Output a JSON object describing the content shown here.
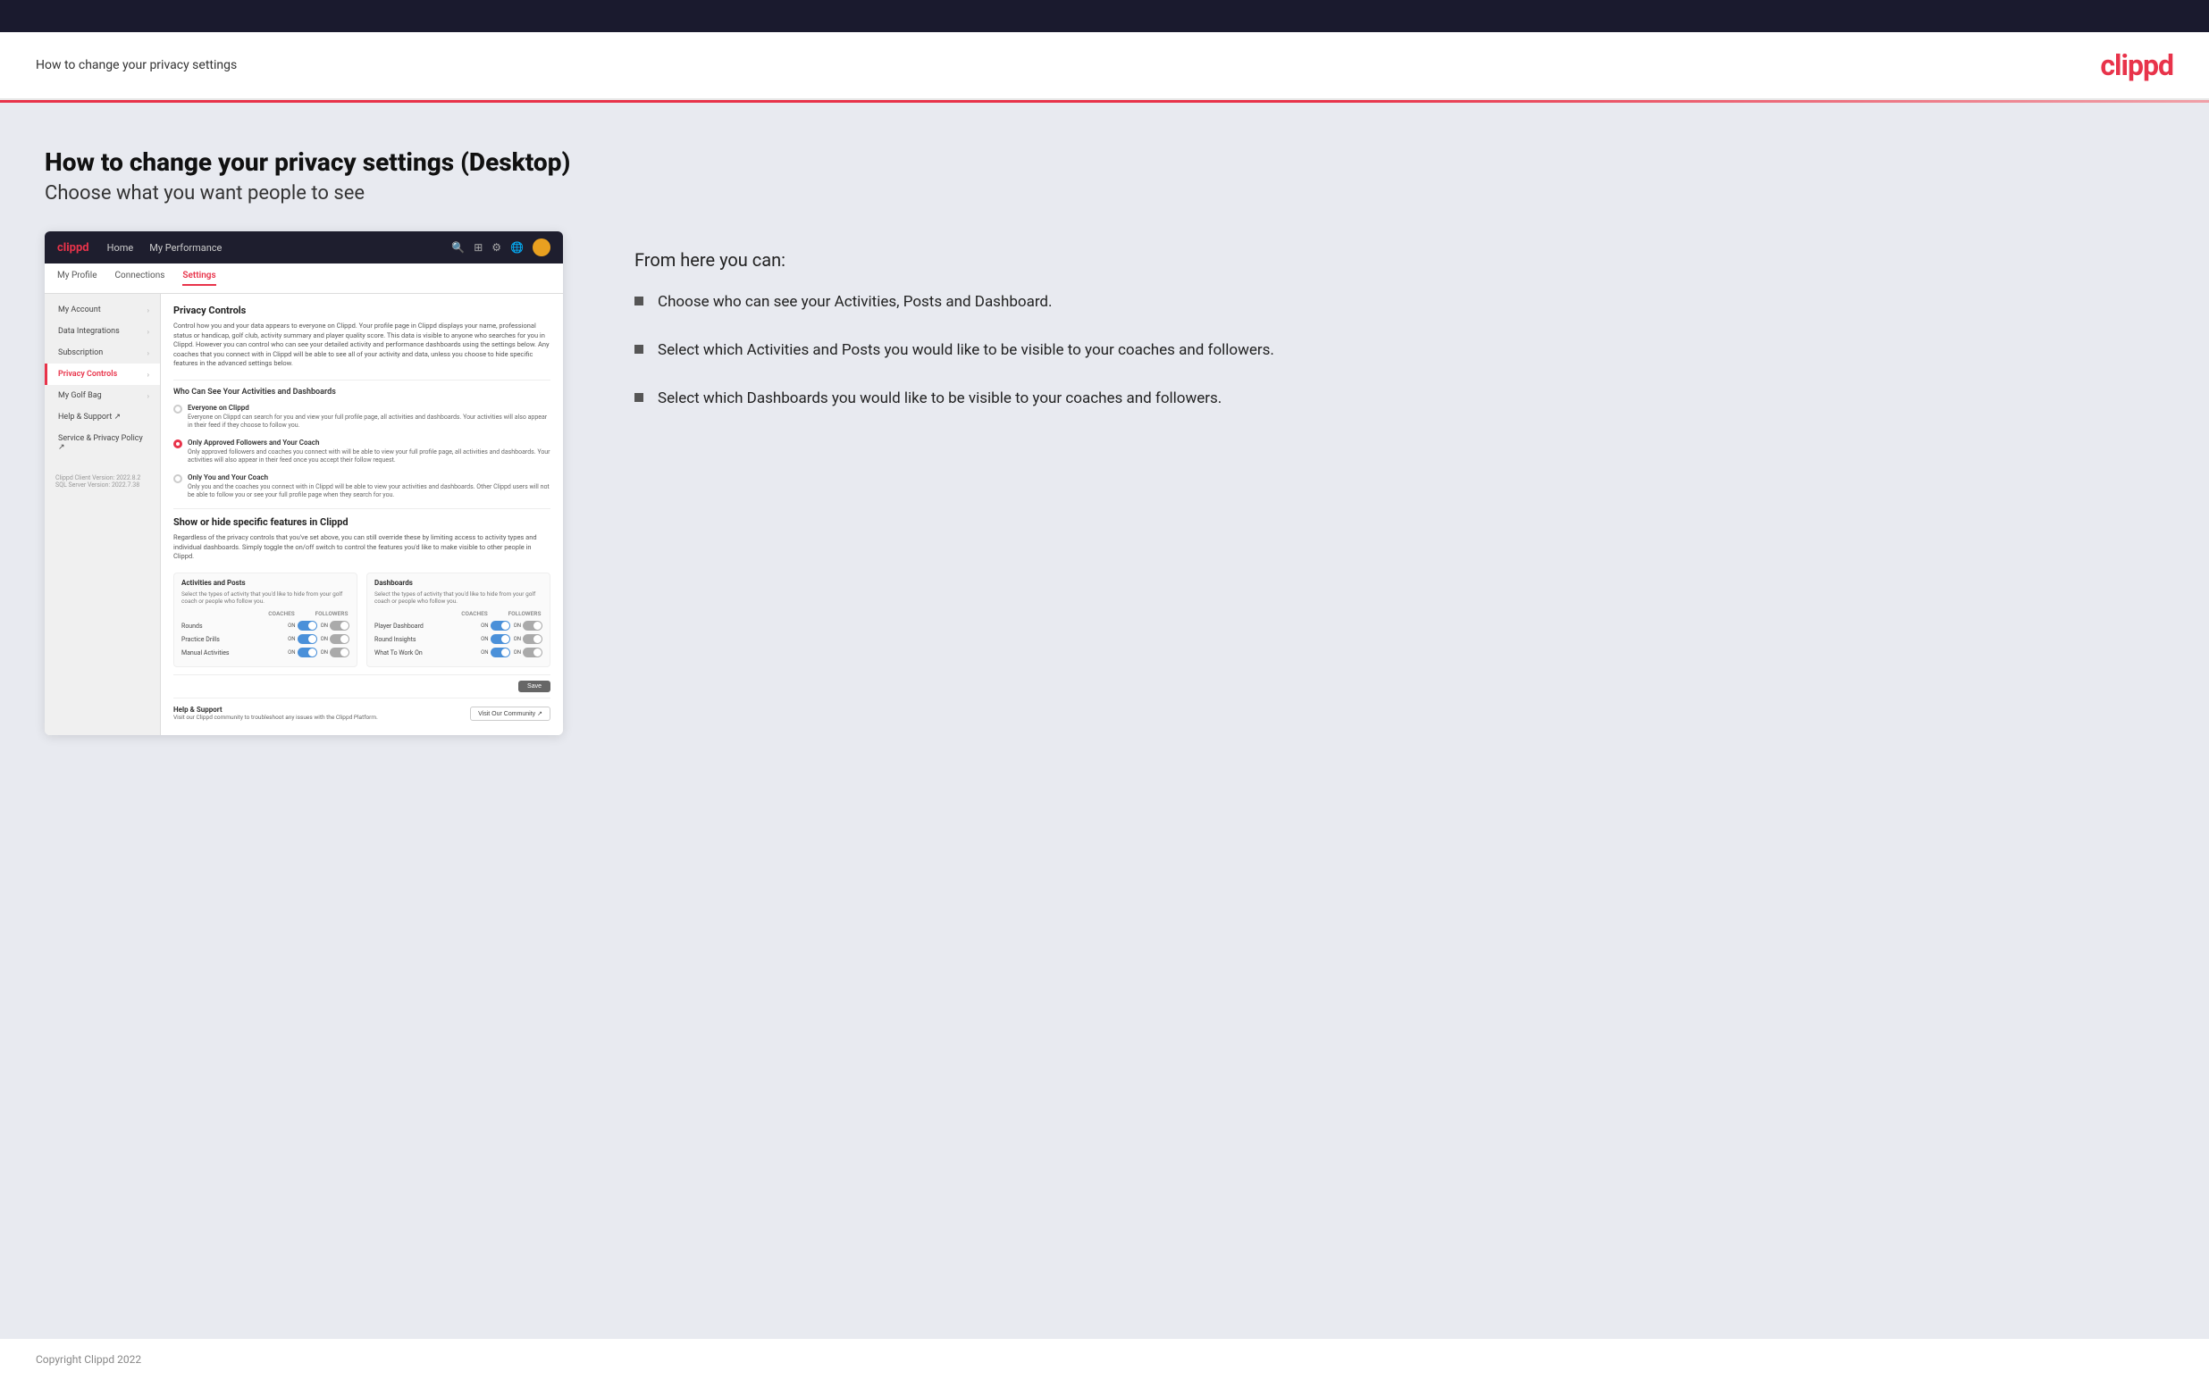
{
  "topBar": {},
  "header": {
    "title": "How to change your privacy settings",
    "logo": "clippd"
  },
  "page": {
    "heading": "How to change your privacy settings (Desktop)",
    "subheading": "Choose what you want people to see"
  },
  "appNav": {
    "logo": "clippd",
    "links": [
      "Home",
      "My Performance"
    ],
    "icons": [
      "search",
      "grid",
      "settings",
      "globe"
    ],
    "subnav": [
      "My Profile",
      "Connections",
      "Settings"
    ]
  },
  "sidebar": {
    "items": [
      {
        "label": "My Account",
        "active": false
      },
      {
        "label": "Data Integrations",
        "active": false
      },
      {
        "label": "Subscription",
        "active": false
      },
      {
        "label": "Privacy Controls",
        "active": true
      },
      {
        "label": "My Golf Bag",
        "active": false
      },
      {
        "label": "Help & Support ↗",
        "active": false
      },
      {
        "label": "Service & Privacy Policy ↗",
        "active": false
      }
    ],
    "version": "Clippd Client Version: 2022.8.2\nSQL Server Version: 2022.7.38"
  },
  "appMain": {
    "sectionTitle": "Privacy Controls",
    "sectionDesc": "Control how you and your data appears to everyone on Clippd. Your profile page in Clippd displays your name, professional status or handicap, golf club, activity summary and player quality score. This data is visible to anyone who searches for you in Clippd. However you can control who can see your detailed activity and performance dashboards using the settings below. Any coaches that you connect with in Clippd will be able to see all of your activity and data, unless you choose to hide specific features in the advanced settings below.",
    "subsectionTitle": "Who Can See Your Activities and Dashboards",
    "radioOptions": [
      {
        "label": "Everyone on Clippd",
        "desc": "Everyone on Clippd can search for you and view your full profile page, all activities and dashboards. Your activities will also appear in their feed if they choose to follow you.",
        "selected": false
      },
      {
        "label": "Only Approved Followers and Your Coach",
        "desc": "Only approved followers and coaches you connect with will be able to view your full profile page, all activities and dashboards. Your activities will also appear in their feed once you accept their follow request.",
        "selected": true
      },
      {
        "label": "Only You and Your Coach",
        "desc": "Only you and the coaches you connect with in Clippd will be able to view your activities and dashboards. Other Clippd users will not be able to follow you or see your full profile page when they search for you.",
        "selected": false
      }
    ],
    "toggleSectionTitle": "Show or hide specific features in Clippd",
    "toggleSectionDesc": "Regardless of the privacy controls that you've set above, you can still override these by limiting access to activity types and individual dashboards. Simply toggle the on/off switch to control the features you'd like to make visible to other people in Clippd.",
    "activitiesCard": {
      "title": "Activities and Posts",
      "desc": "Select the types of activity that you'd like to hide from your golf coach or people who follow you.",
      "colHeaders": [
        "COACHES",
        "FOLLOWERS"
      ],
      "rows": [
        {
          "label": "Rounds",
          "coachOn": true,
          "followerOn": true
        },
        {
          "label": "Practice Drills",
          "coachOn": true,
          "followerOn": true
        },
        {
          "label": "Manual Activities",
          "coachOn": true,
          "followerOn": true
        }
      ]
    },
    "dashboardsCard": {
      "title": "Dashboards",
      "desc": "Select the types of activity that you'd like to hide from your golf coach or people who follow you.",
      "colHeaders": [
        "COACHES",
        "FOLLOWERS"
      ],
      "rows": [
        {
          "label": "Player Dashboard",
          "coachOn": true,
          "followerOn": true
        },
        {
          "label": "Round Insights",
          "coachOn": true,
          "followerOn": true
        },
        {
          "label": "What To Work On",
          "coachOn": true,
          "followerOn": true
        }
      ]
    },
    "saveButton": "Save",
    "helpSection": {
      "title": "Help & Support",
      "desc": "Visit our Clippd community to troubleshoot any issues with the Clippd Platform.",
      "button": "Visit Our Community ↗"
    }
  },
  "rightPanel": {
    "fromHere": "From here you can:",
    "bullets": [
      "Choose who can see your Activities, Posts and Dashboard.",
      "Select which Activities and Posts you would like to be visible to your coaches and followers.",
      "Select which Dashboards you would like to be visible to your coaches and followers."
    ]
  },
  "footer": {
    "copyright": "Copyright Clippd 2022"
  }
}
